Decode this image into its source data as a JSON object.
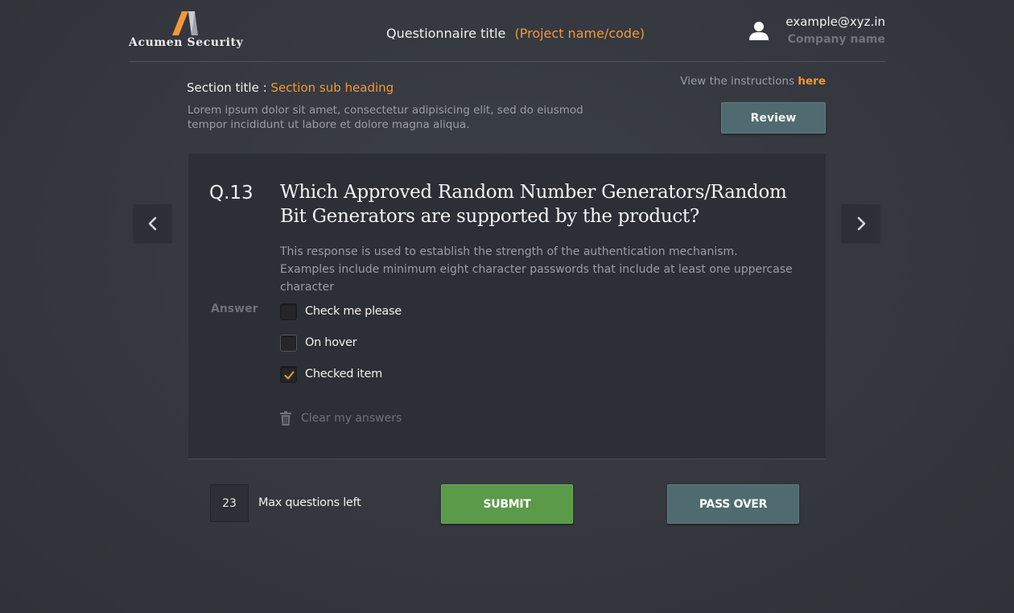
{
  "header": {
    "logo_text": "Acumen Security",
    "questionnaire_title": "Questionnaire title",
    "project_name": "(Project name/code)",
    "user_email": "example@xyz.in",
    "company_name": "Company name"
  },
  "section": {
    "title_prefix": "Section title : ",
    "sub_heading": "Section sub heading",
    "description": "Lorem ipsum dolor sit amet, consectetur adipisicing elit, sed do eiusmod tempor incididunt ut labore et dolore magna aliqua.",
    "instructions_text": "View the instructions ",
    "instructions_link": "here",
    "review_label": "Review"
  },
  "question": {
    "number": "Q.13",
    "text": "Which Approved Random Number Generators/Random Bit Generators are supported by the product?",
    "description": "This response is used to establish the strength of the authentication mechanism. Examples include minimum eight character passwords that include at least one uppercase character",
    "answer_label": "Answer",
    "options": [
      {
        "label": "Check me please",
        "checked": false
      },
      {
        "label": "On hover",
        "checked": false
      },
      {
        "label": "Checked item",
        "checked": true
      }
    ],
    "clear_label": "Clear my answers"
  },
  "footer": {
    "questions_left": "23",
    "questions_left_label": "Max questions left",
    "submit_label": "SUBMIT",
    "pass_label": "PASS OVER"
  },
  "colors": {
    "accent": "#f2973a",
    "submit": "#5b9a48",
    "secondary_button": "#4f6b70",
    "background": "#363a41",
    "card": "#2c2f35"
  },
  "icons": {
    "logo": "acumen-a-logo",
    "user": "user-icon",
    "prev": "chevron-left-icon",
    "next": "chevron-right-icon",
    "check": "check-icon",
    "trash": "trash-icon"
  }
}
